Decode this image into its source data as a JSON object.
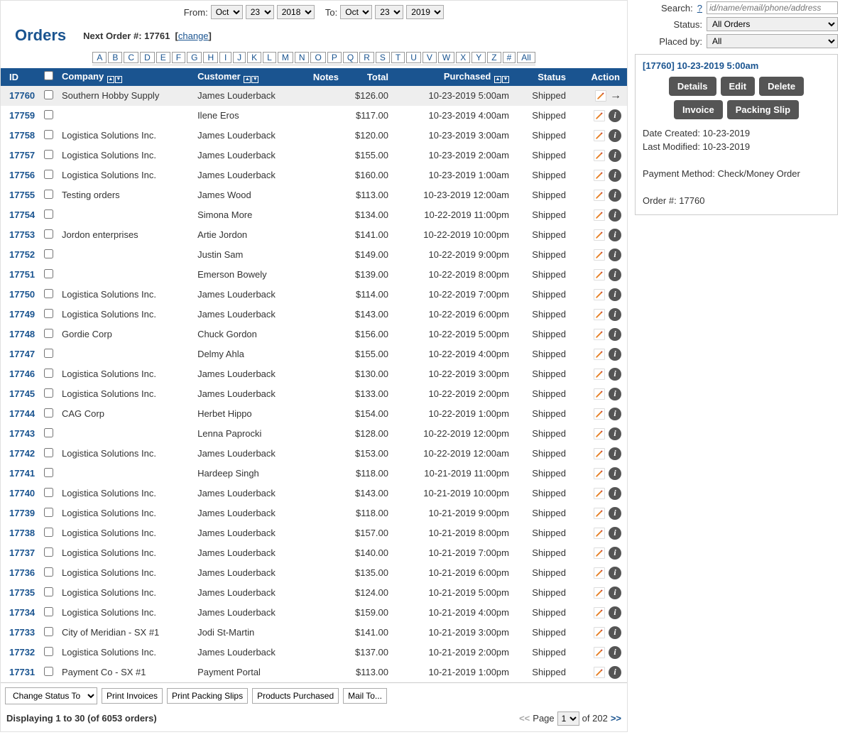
{
  "header": {
    "title": "Orders",
    "from_label": "From:",
    "to_label": "To:",
    "from_month": "Oct",
    "from_day": "23",
    "from_year": "2018",
    "to_month": "Oct",
    "to_day": "23",
    "to_year": "2019",
    "next_order_label": "Next Order #:",
    "next_order_num": "17761",
    "change_link": "change"
  },
  "letters": [
    "A",
    "B",
    "C",
    "D",
    "E",
    "F",
    "G",
    "H",
    "I",
    "J",
    "K",
    "L",
    "M",
    "N",
    "O",
    "P",
    "Q",
    "R",
    "S",
    "T",
    "U",
    "V",
    "W",
    "X",
    "Y",
    "Z",
    "#",
    "All"
  ],
  "search": {
    "search_label": "Search:",
    "search_help": "?",
    "search_placeholder": "id/name/email/phone/address",
    "status_label": "Status:",
    "status_value": "All Orders",
    "placedby_label": "Placed by:",
    "placedby_value": "All"
  },
  "columns": {
    "id": "ID",
    "company": "Company",
    "customer": "Customer",
    "notes": "Notes",
    "total": "Total",
    "purchased": "Purchased",
    "status": "Status",
    "action": "Action"
  },
  "rows": [
    {
      "id": "17760",
      "company": "Southern Hobby Supply",
      "customer": "James Louderback",
      "total": "$126.00",
      "purchased": "10-23-2019 5:00am",
      "status": "Shipped",
      "selected": true
    },
    {
      "id": "17759",
      "company": "",
      "customer": "Ilene Eros",
      "total": "$117.00",
      "purchased": "10-23-2019 4:00am",
      "status": "Shipped"
    },
    {
      "id": "17758",
      "company": "Logistica Solutions Inc.",
      "customer": "James Louderback",
      "total": "$120.00",
      "purchased": "10-23-2019 3:00am",
      "status": "Shipped"
    },
    {
      "id": "17757",
      "company": "Logistica Solutions Inc.",
      "customer": "James Louderback",
      "total": "$155.00",
      "purchased": "10-23-2019 2:00am",
      "status": "Shipped"
    },
    {
      "id": "17756",
      "company": "Logistica Solutions Inc.",
      "customer": "James Louderback",
      "total": "$160.00",
      "purchased": "10-23-2019 1:00am",
      "status": "Shipped"
    },
    {
      "id": "17755",
      "company": "Testing orders",
      "customer": "James Wood",
      "total": "$113.00",
      "purchased": "10-23-2019 12:00am",
      "status": "Shipped"
    },
    {
      "id": "17754",
      "company": "",
      "customer": "Simona More",
      "total": "$134.00",
      "purchased": "10-22-2019 11:00pm",
      "status": "Shipped"
    },
    {
      "id": "17753",
      "company": "Jordon enterprises",
      "customer": "Artie Jordon",
      "total": "$141.00",
      "purchased": "10-22-2019 10:00pm",
      "status": "Shipped"
    },
    {
      "id": "17752",
      "company": "",
      "customer": "Justin Sam",
      "total": "$149.00",
      "purchased": "10-22-2019 9:00pm",
      "status": "Shipped"
    },
    {
      "id": "17751",
      "company": "",
      "customer": "Emerson Bowely",
      "total": "$139.00",
      "purchased": "10-22-2019 8:00pm",
      "status": "Shipped"
    },
    {
      "id": "17750",
      "company": "Logistica Solutions Inc.",
      "customer": "James Louderback",
      "total": "$114.00",
      "purchased": "10-22-2019 7:00pm",
      "status": "Shipped"
    },
    {
      "id": "17749",
      "company": "Logistica Solutions Inc.",
      "customer": "James Louderback",
      "total": "$143.00",
      "purchased": "10-22-2019 6:00pm",
      "status": "Shipped"
    },
    {
      "id": "17748",
      "company": "Gordie Corp",
      "customer": "Chuck Gordon",
      "total": "$156.00",
      "purchased": "10-22-2019 5:00pm",
      "status": "Shipped"
    },
    {
      "id": "17747",
      "company": "",
      "customer": "Delmy Ahla",
      "total": "$155.00",
      "purchased": "10-22-2019 4:00pm",
      "status": "Shipped"
    },
    {
      "id": "17746",
      "company": "Logistica Solutions Inc.",
      "customer": "James Louderback",
      "total": "$130.00",
      "purchased": "10-22-2019 3:00pm",
      "status": "Shipped"
    },
    {
      "id": "17745",
      "company": "Logistica Solutions Inc.",
      "customer": "James Louderback",
      "total": "$133.00",
      "purchased": "10-22-2019 2:00pm",
      "status": "Shipped"
    },
    {
      "id": "17744",
      "company": "CAG Corp",
      "customer": "Herbet Hippo",
      "total": "$154.00",
      "purchased": "10-22-2019 1:00pm",
      "status": "Shipped"
    },
    {
      "id": "17743",
      "company": "",
      "customer": "Lenna Paprocki",
      "total": "$128.00",
      "purchased": "10-22-2019 12:00pm",
      "status": "Shipped"
    },
    {
      "id": "17742",
      "company": "Logistica Solutions Inc.",
      "customer": "James Louderback",
      "total": "$153.00",
      "purchased": "10-22-2019 12:00am",
      "status": "Shipped"
    },
    {
      "id": "17741",
      "company": "",
      "customer": "Hardeep Singh",
      "total": "$118.00",
      "purchased": "10-21-2019 11:00pm",
      "status": "Shipped"
    },
    {
      "id": "17740",
      "company": "Logistica Solutions Inc.",
      "customer": "James Louderback",
      "total": "$143.00",
      "purchased": "10-21-2019 10:00pm",
      "status": "Shipped"
    },
    {
      "id": "17739",
      "company": "Logistica Solutions Inc.",
      "customer": "James Louderback",
      "total": "$118.00",
      "purchased": "10-21-2019 9:00pm",
      "status": "Shipped"
    },
    {
      "id": "17738",
      "company": "Logistica Solutions Inc.",
      "customer": "James Louderback",
      "total": "$157.00",
      "purchased": "10-21-2019 8:00pm",
      "status": "Shipped"
    },
    {
      "id": "17737",
      "company": "Logistica Solutions Inc.",
      "customer": "James Louderback",
      "total": "$140.00",
      "purchased": "10-21-2019 7:00pm",
      "status": "Shipped"
    },
    {
      "id": "17736",
      "company": "Logistica Solutions Inc.",
      "customer": "James Louderback",
      "total": "$135.00",
      "purchased": "10-21-2019 6:00pm",
      "status": "Shipped"
    },
    {
      "id": "17735",
      "company": "Logistica Solutions Inc.",
      "customer": "James Louderback",
      "total": "$124.00",
      "purchased": "10-21-2019 5:00pm",
      "status": "Shipped"
    },
    {
      "id": "17734",
      "company": "Logistica Solutions Inc.",
      "customer": "James Louderback",
      "total": "$159.00",
      "purchased": "10-21-2019 4:00pm",
      "status": "Shipped"
    },
    {
      "id": "17733",
      "company": "City of Meridian - SX #1",
      "customer": "Jodi St-Martin",
      "total": "$141.00",
      "purchased": "10-21-2019 3:00pm",
      "status": "Shipped"
    },
    {
      "id": "17732",
      "company": "Logistica Solutions Inc.",
      "customer": "James Louderback",
      "total": "$137.00",
      "purchased": "10-21-2019 2:00pm",
      "status": "Shipped"
    },
    {
      "id": "17731",
      "company": "Payment Co - SX #1",
      "customer": "Payment Portal",
      "total": "$113.00",
      "purchased": "10-21-2019 1:00pm",
      "status": "Shipped"
    }
  ],
  "bottom": {
    "change_status": "Change Status To",
    "print_invoices": "Print Invoices",
    "print_packing": "Print Packing Slips",
    "products_purchased": "Products Purchased",
    "mail_to": "Mail To..."
  },
  "pager": {
    "display": "Displaying 1 to 30 (of 6053 orders)",
    "prev": "<<",
    "page_label": "Page",
    "page_value": "1",
    "of_label": "of 202",
    "next": ">>"
  },
  "detail": {
    "title": "[17760]  10-23-2019 5:00am",
    "btn_details": "Details",
    "btn_edit": "Edit",
    "btn_delete": "Delete",
    "btn_invoice": "Invoice",
    "btn_packing": "Packing Slip",
    "date_created": "Date Created: 10-23-2019",
    "last_modified": "Last Modified: 10-23-2019",
    "payment_method": "Payment Method: Check/Money Order",
    "order_num": "Order #: 17760"
  }
}
